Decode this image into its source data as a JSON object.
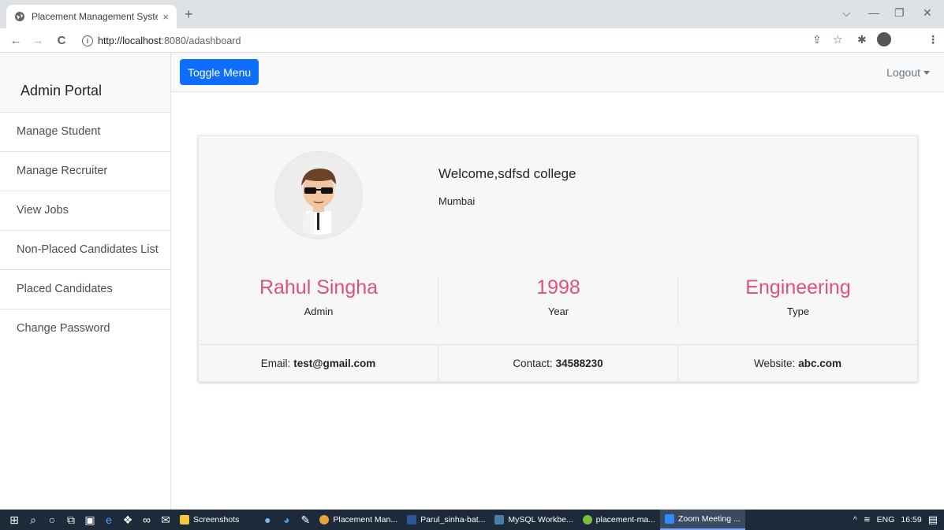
{
  "browser": {
    "tab_title": "Placement Management System",
    "tab_close": "×",
    "new_tab": "+",
    "url_host": "http://localhost",
    "url_path": ":8080/adashboard"
  },
  "sidebar": {
    "title": "Admin Portal",
    "items": [
      {
        "label": "Manage Student"
      },
      {
        "label": "Manage Recruiter"
      },
      {
        "label": "View Jobs"
      },
      {
        "label": "Non-Placed Candidates List"
      },
      {
        "label": "Placed Candidates"
      },
      {
        "label": "Change Password"
      }
    ]
  },
  "topbar": {
    "toggle_label": "Toggle Menu",
    "logout_label": "Logout"
  },
  "profile": {
    "welcome": "Welcome,sdfsd college",
    "city": "Mumbai",
    "stats": [
      {
        "value": "Rahul Singha",
        "label": "Admin"
      },
      {
        "value": "1998",
        "label": "Year"
      },
      {
        "value": "Engineering",
        "label": "Type"
      }
    ],
    "email_label": "Email:",
    "email": "test@gmail.com",
    "contact_label": "Contact:",
    "contact": "34588230",
    "website_label": "Website:",
    "website": "abc.com",
    "accent_color": "#e0507e"
  },
  "taskbar": {
    "apps": [
      {
        "label": "Screenshots",
        "color": "#f5c542"
      },
      {
        "label": "Placement Man...",
        "color": "#e8a33b"
      },
      {
        "label": "Parul_sinha-bat...",
        "color": "#2b5797"
      },
      {
        "label": "MySQL Workbe...",
        "color": "#4a7da8"
      },
      {
        "label": "placement-ma...",
        "color": "#7cbf3c"
      },
      {
        "label": "Zoom Meeting ...",
        "color": "#2d8cff"
      }
    ],
    "lang": "ENG",
    "time": "16:59"
  }
}
